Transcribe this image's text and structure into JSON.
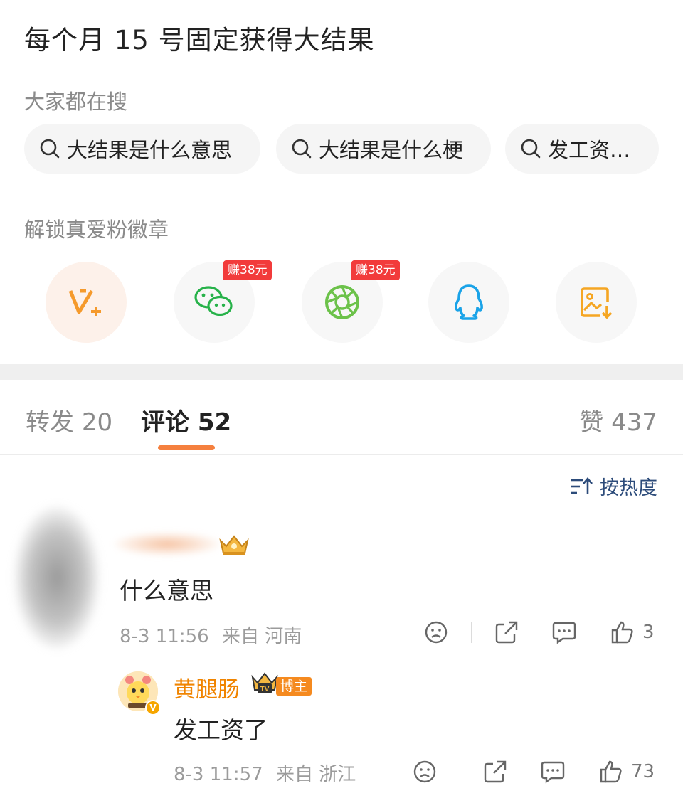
{
  "post": {
    "title": "每个月 15 号固定获得大结果"
  },
  "search": {
    "label": "大家都在搜",
    "chips": [
      "大结果是什么意思",
      "大结果是什么梗",
      "发工资…"
    ]
  },
  "badge": {
    "label": "解锁真爱粉徽章",
    "share_buttons": [
      {
        "icon": "vplus-icon",
        "tag": ""
      },
      {
        "icon": "wechat-icon",
        "tag": "赚38元"
      },
      {
        "icon": "moments-icon",
        "tag": "赚38元"
      },
      {
        "icon": "qq-icon",
        "tag": ""
      },
      {
        "icon": "save-image-icon",
        "tag": ""
      }
    ]
  },
  "tabs": {
    "repost": {
      "label": "转发",
      "count": "20"
    },
    "comment": {
      "label": "评论",
      "count": "52"
    },
    "like": {
      "label": "赞",
      "count": "437"
    }
  },
  "sort": {
    "label": "按热度"
  },
  "comments": [
    {
      "text": "什么意思",
      "date": "8-3 11:56",
      "source": "来自 河南",
      "likes": "3",
      "replies": [
        {
          "author": "黄腿肠",
          "badge": "博主",
          "text": "发工资了",
          "date": "8-3 11:57",
          "source": "来自 浙江",
          "likes": "73"
        }
      ]
    }
  ],
  "colors": {
    "accent": "#f5803e",
    "link": "#2c4b7a",
    "earn_tag": "#f23b3b",
    "author": "#f08400"
  }
}
